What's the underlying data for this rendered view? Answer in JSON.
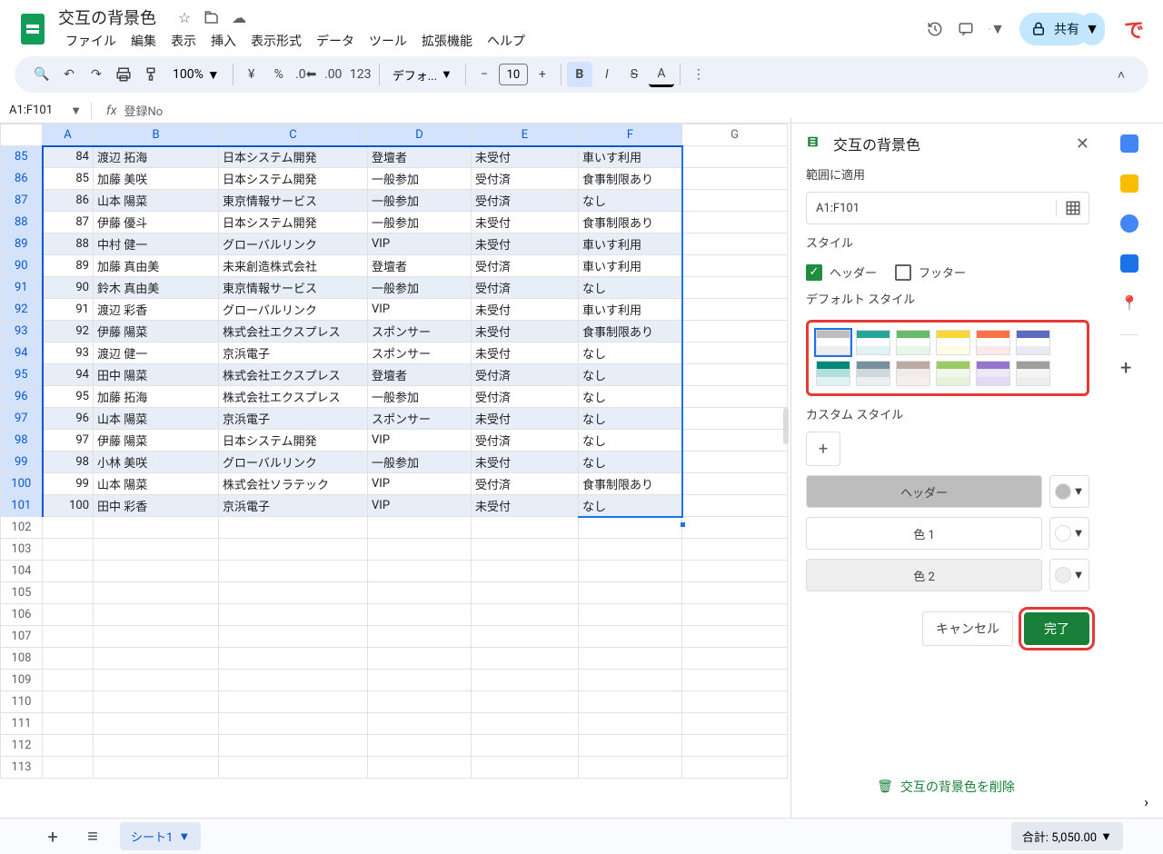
{
  "title": "交互の背景色",
  "menu": [
    "ファイル",
    "編集",
    "表示",
    "挿入",
    "表示形式",
    "データ",
    "ツール",
    "拡張機能",
    "ヘルプ"
  ],
  "toolbar": {
    "zoom": "100%",
    "currency": "¥",
    "percent": "%",
    "format123": "123",
    "font": "デフォ...",
    "fontsize": "10"
  },
  "share": "共有",
  "namebox": "A1:F101",
  "formula": "登録No",
  "columns": [
    "A",
    "B",
    "C",
    "D",
    "E",
    "F",
    "G"
  ],
  "rows": [
    {
      "n": 85,
      "a": 84,
      "b": "渡辺 拓海",
      "c": "日本システム開発",
      "d": "登壇者",
      "e": "未受付",
      "f": "車いす利用"
    },
    {
      "n": 86,
      "a": 85,
      "b": "加藤 美咲",
      "c": "日本システム開発",
      "d": "一般参加",
      "e": "受付済",
      "f": "食事制限あり"
    },
    {
      "n": 87,
      "a": 86,
      "b": "山本 陽菜",
      "c": "東京情報サービス",
      "d": "一般参加",
      "e": "受付済",
      "f": "なし"
    },
    {
      "n": 88,
      "a": 87,
      "b": "伊藤 優斗",
      "c": "日本システム開発",
      "d": "一般参加",
      "e": "未受付",
      "f": "食事制限あり"
    },
    {
      "n": 89,
      "a": 88,
      "b": "中村 健一",
      "c": "グローバルリンク",
      "d": "VIP",
      "e": "未受付",
      "f": "車いす利用"
    },
    {
      "n": 90,
      "a": 89,
      "b": "加藤 真由美",
      "c": "未来創造株式会社",
      "d": "登壇者",
      "e": "受付済",
      "f": "車いす利用"
    },
    {
      "n": 91,
      "a": 90,
      "b": "鈴木 真由美",
      "c": "東京情報サービス",
      "d": "一般参加",
      "e": "受付済",
      "f": "なし"
    },
    {
      "n": 92,
      "a": 91,
      "b": "渡辺 彩香",
      "c": "グローバルリンク",
      "d": "VIP",
      "e": "未受付",
      "f": "車いす利用"
    },
    {
      "n": 93,
      "a": 92,
      "b": "伊藤 陽菜",
      "c": "株式会社エクスプレス",
      "d": "スポンサー",
      "e": "未受付",
      "f": "食事制限あり"
    },
    {
      "n": 94,
      "a": 93,
      "b": "渡辺 健一",
      "c": "京浜電子",
      "d": "スポンサー",
      "e": "未受付",
      "f": "なし"
    },
    {
      "n": 95,
      "a": 94,
      "b": "田中 陽菜",
      "c": "株式会社エクスプレス",
      "d": "登壇者",
      "e": "受付済",
      "f": "なし"
    },
    {
      "n": 96,
      "a": 95,
      "b": "加藤 拓海",
      "c": "株式会社エクスプレス",
      "d": "一般参加",
      "e": "受付済",
      "f": "なし"
    },
    {
      "n": 97,
      "a": 96,
      "b": "山本 陽菜",
      "c": "京浜電子",
      "d": "スポンサー",
      "e": "未受付",
      "f": "なし"
    },
    {
      "n": 98,
      "a": 97,
      "b": "伊藤 陽菜",
      "c": "日本システム開発",
      "d": "VIP",
      "e": "受付済",
      "f": "なし"
    },
    {
      "n": 99,
      "a": 98,
      "b": "小林 美咲",
      "c": "グローバルリンク",
      "d": "一般参加",
      "e": "未受付",
      "f": "なし"
    },
    {
      "n": 100,
      "a": 99,
      "b": "山本 陽菜",
      "c": "株式会社ソラテック",
      "d": "VIP",
      "e": "受付済",
      "f": "食事制限あり"
    },
    {
      "n": 101,
      "a": 100,
      "b": "田中 彩香",
      "c": "京浜電子",
      "d": "VIP",
      "e": "未受付",
      "f": "なし"
    }
  ],
  "emptyRows": [
    102,
    103,
    104,
    105,
    106,
    107,
    108,
    109,
    110,
    111,
    112,
    113
  ],
  "sidepanel": {
    "title": "交互の背景色",
    "apply_label": "範囲に適用",
    "range": "A1:F101",
    "style_label": "スタイル",
    "header_chk": "ヘッダー",
    "footer_chk": "フッター",
    "default_label": "デフォルト スタイル",
    "custom_label": "カスタム スタイル",
    "hdr": "ヘッダー",
    "c1": "色 1",
    "c2": "色 2",
    "cancel": "キャンセル",
    "done": "完了",
    "remove": "交互の背景色を削除"
  },
  "sheet_tab": "シート1",
  "status": "合計: 5,050.00"
}
